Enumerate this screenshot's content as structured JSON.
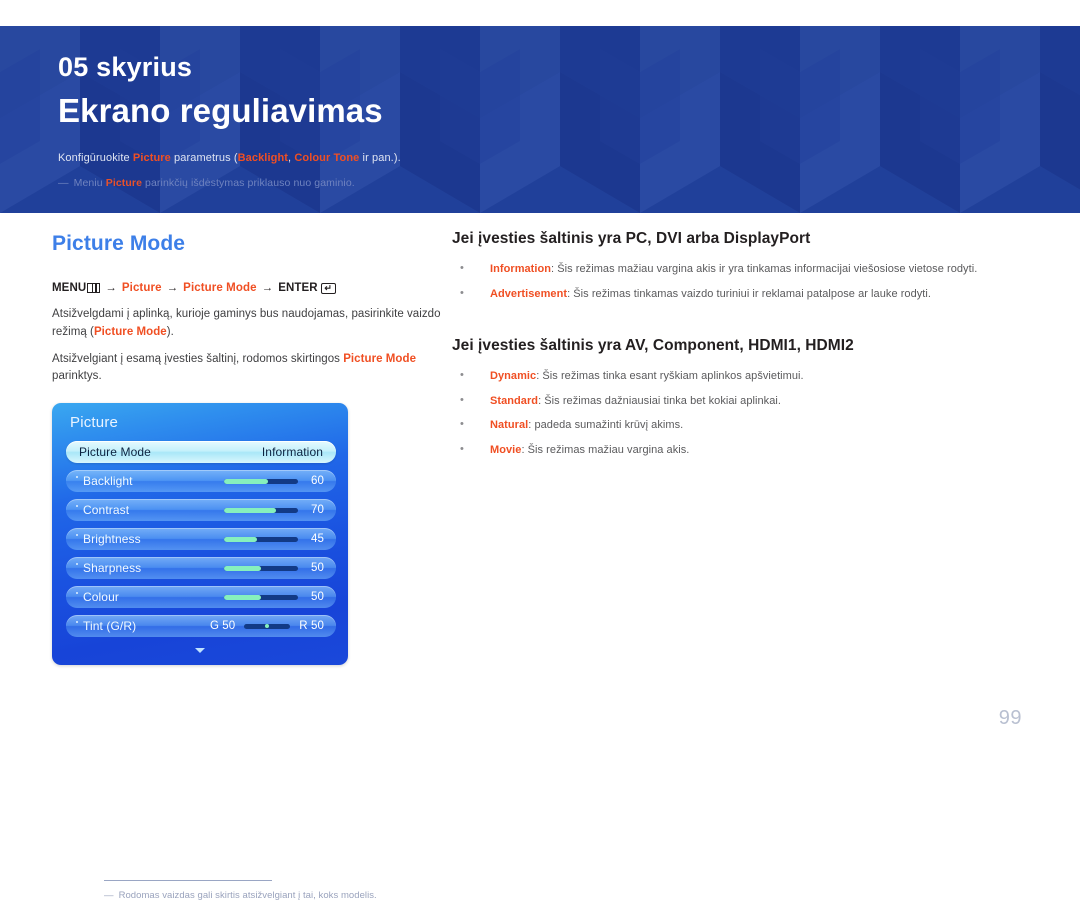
{
  "banner": {
    "chapter_no": "05 skyrius",
    "title": "Ekrano reguliavimas",
    "desc_prefix": "Konfigūruokite ",
    "desc_kw1": "Picture",
    "desc_mid": " parametrus (",
    "desc_kw2": "Backlight",
    "desc_sep": ", ",
    "desc_kw3": "Colour Tone",
    "desc_suffix": " ir pan.).",
    "note_dash": "―",
    "note_prefix": "Meniu ",
    "note_kw": "Picture",
    "note_suffix": " parinkčių išdėstymas priklauso nuo gaminio.",
    "bg_color": "#20409a"
  },
  "left": {
    "heading": "Picture Mode",
    "heading_color": "#3d7fe8",
    "menupath": {
      "menu_label": "MENU",
      "menu_icon": "menu-bars-icon",
      "arrow": "→",
      "step1": "Picture",
      "step2": "Picture Mode",
      "enter_label": "ENTER",
      "enter_icon": "enter-key-icon",
      "enter_glyph": "↵"
    },
    "para1_a": "Atsižvelgdami į aplinką, kurioje gaminys bus naudojamas, pasirinkite vaizdo režimą (",
    "para1_b": "Picture Mode",
    "para1_c": ").",
    "para2_a": "Atsižvelgiant į esamą įvesties šaltinį, rodomos skirtingos ",
    "para2_b": "Picture Mode",
    "para2_c": " parinktys."
  },
  "osd": {
    "title": "Picture",
    "rows": [
      {
        "label": "Picture Mode",
        "value": "Information",
        "type": "value",
        "selected": true
      },
      {
        "label": "Backlight",
        "value": "60",
        "type": "slider",
        "fill_pct": 60,
        "selected": false
      },
      {
        "label": "Contrast",
        "value": "70",
        "type": "slider",
        "fill_pct": 70,
        "selected": false
      },
      {
        "label": "Brightness",
        "value": "45",
        "type": "slider",
        "fill_pct": 45,
        "selected": false
      },
      {
        "label": "Sharpness",
        "value": "50",
        "type": "slider",
        "fill_pct": 50,
        "selected": false
      },
      {
        "label": "Colour",
        "value": "50",
        "type": "slider",
        "fill_pct": 50,
        "selected": false
      },
      {
        "label": "Tint (G/R)",
        "left_label": "G 50",
        "right_label": "R 50",
        "type": "tint",
        "selected": false
      }
    ],
    "scroll_caret": "▼"
  },
  "footnote": {
    "dash": "―",
    "text": "Rodomas vaizdas gali skirtis atsižvelgiant į tai, koks modelis."
  },
  "right": {
    "heading1": "Jei įvesties šaltinis yra PC, DVI arba DisplayPort",
    "bullets1": [
      {
        "term": "Information",
        "text": ": Šis režimas mažiau vargina akis ir yra tinkamas informacijai viešosiose vietose rodyti."
      },
      {
        "term": "Advertisement",
        "text": ": Šis režimas tinkamas vaizdo turiniui ir reklamai patalpose ar lauke rodyti."
      }
    ],
    "heading2": "Jei įvesties šaltinis yra AV, Component, HDMI1, HDMI2",
    "bullets2": [
      {
        "term": "Dynamic",
        "text": ": Šis režimas tinka esant ryškiam aplinkos apšvietimui."
      },
      {
        "term": "Standard",
        "text": ": Šis režimas dažniausiai tinka bet kokiai aplinkai."
      },
      {
        "term": "Natural",
        "text": ": padeda sumažinti krūvį akims."
      },
      {
        "term": "Movie",
        "text": ": Šis režimas mažiau vargina akis."
      }
    ],
    "accent_color": "#f04f23"
  },
  "page_number": "99"
}
